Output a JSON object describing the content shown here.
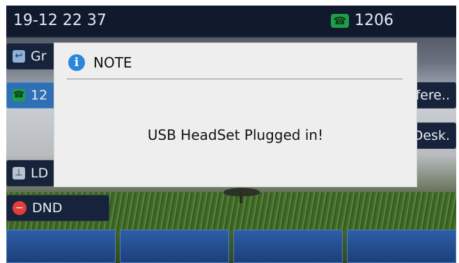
{
  "status_bar": {
    "time": "19-12 22 37",
    "line_label": "1206"
  },
  "side_keys": {
    "left": [
      {
        "label": "Gr",
        "icon": "call-history-icon"
      },
      {
        "label": "12",
        "icon": "line-phone-icon"
      },
      {
        "label": "LD",
        "icon": "contact-icon"
      },
      {
        "label": "DND",
        "icon": "dnd-icon"
      }
    ],
    "right": [
      {
        "label": "fere.."
      },
      {
        "label": "Desk."
      }
    ]
  },
  "softkeys": [
    "",
    "",
    "",
    ""
  ],
  "dialog": {
    "title": "NOTE",
    "icon": "info-icon",
    "message": "USB HeadSet Plugged in!"
  },
  "colors": {
    "status_bar": "#101a2c",
    "key_blue": "#2f6fb3",
    "dialog_bg": "#eeeeee",
    "dnd_red": "#e0403a",
    "line_green": "#1f9e4a"
  }
}
